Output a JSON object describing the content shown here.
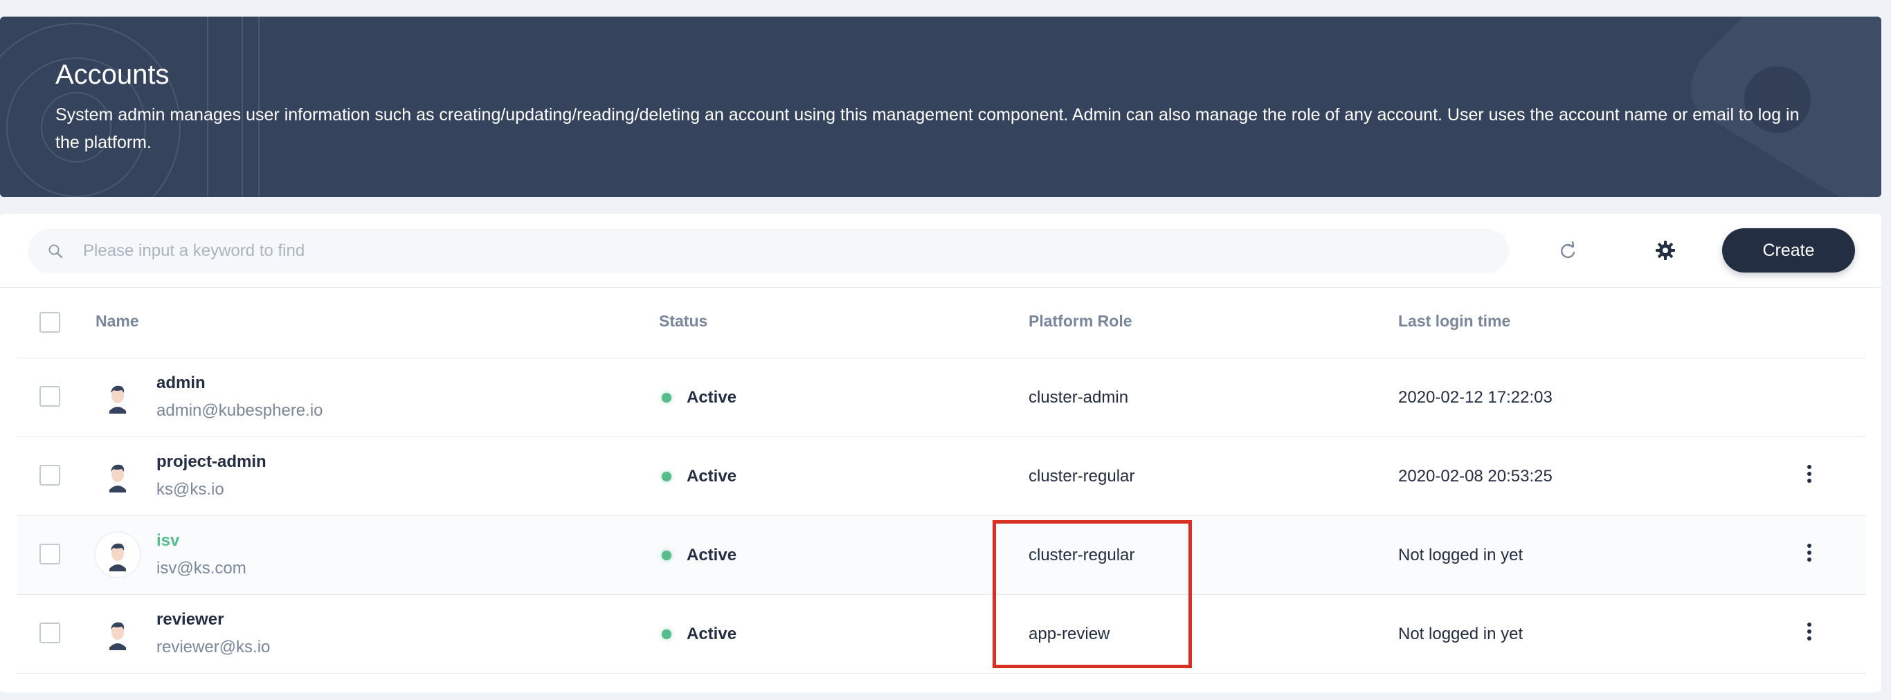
{
  "banner": {
    "title": "Accounts",
    "description": "System admin manages user information such as creating/updating/reading/deleting an account using this management component. Admin can also manage the role of any account. User uses the account name or email to log in the platform."
  },
  "toolbar": {
    "search_placeholder": "Please input a keyword to find",
    "create_label": "Create"
  },
  "table": {
    "columns": [
      "Name",
      "Status",
      "Platform Role",
      "Last login time"
    ],
    "rows": [
      {
        "name": "admin",
        "email": "admin@kubesphere.io",
        "status": "Active",
        "role": "cluster-admin",
        "last_login": "2020-02-12 17:22:03",
        "has_menu": false
      },
      {
        "name": "project-admin",
        "email": "ks@ks.io",
        "status": "Active",
        "role": "cluster-regular",
        "last_login": "2020-02-08 20:53:25",
        "has_menu": true
      },
      {
        "name": "isv",
        "email": "isv@ks.com",
        "status": "Active",
        "role": "cluster-regular",
        "last_login": "Not logged in yet",
        "has_menu": true
      },
      {
        "name": "reviewer",
        "email": "reviewer@ks.io",
        "status": "Active",
        "role": "app-review",
        "last_login": "Not logged in yet",
        "has_menu": true
      }
    ]
  },
  "colors": {
    "banner_bg": "#36435c",
    "primary_button": "#242e42",
    "status_active": "#55bc8a",
    "link_hover": "#55bc8a",
    "annotation": "#d93025"
  },
  "icons": [
    "search-icon",
    "refresh-icon",
    "gear-icon",
    "avatar-icon",
    "more-vertical-icon"
  ]
}
